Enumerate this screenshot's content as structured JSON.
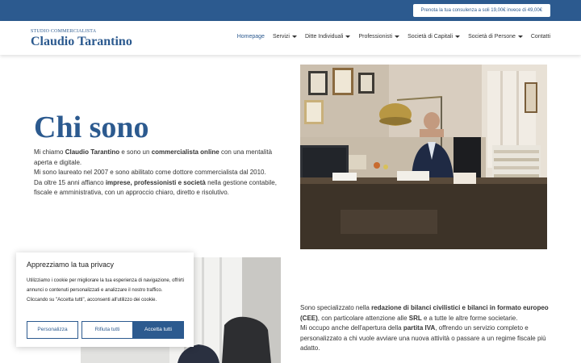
{
  "topbar": {
    "promo_label": "Prenota la tua consulenza a soli 19,00€ invece di 49,00€"
  },
  "brand": {
    "subtitle": "STUDIO COMMERCIALISTA",
    "name": "Claudio Tarantino"
  },
  "nav": {
    "items": [
      {
        "label": "Homepage",
        "active": true,
        "dropdown": false
      },
      {
        "label": "Servizi",
        "dropdown": true
      },
      {
        "label": "Ditte Individuali",
        "dropdown": true
      },
      {
        "label": "Professionisti",
        "dropdown": true
      },
      {
        "label": "Società di Capitali",
        "dropdown": true
      },
      {
        "label": "Società di Persone",
        "dropdown": true
      },
      {
        "label": "Contatti",
        "dropdown": false
      }
    ]
  },
  "main": {
    "title": "Chi sono",
    "intro": {
      "p1_a": "Mi chiamo ",
      "p1_b": "Claudio Tarantino",
      "p1_c": " e sono un ",
      "p1_d": "commercialista online",
      "p1_e": " con una mentalità aperta e digitale.",
      "p2": "Mi sono laureato nel 2007 e sono abilitato come dottore commercialista dal 2010.",
      "p3_a": "Da oltre 15 anni affianco ",
      "p3_b": "imprese, professionisti e società",
      "p3_c": " nella gestione contabile, fiscale e amministrativa, con un approccio chiaro, diretto e risolutivo."
    },
    "second": {
      "s1_a": "Sono specializzato nella ",
      "s1_b": "redazione di bilanci civilistici e bilanci in formato europeo (CEE)",
      "s1_c": ", con particolare attenzione alle ",
      "s1_d": "SRL",
      "s1_e": " e a tutte le altre forme societarie.",
      "s2_a": "Mi occupo anche dell'apertura della ",
      "s2_b": "partita IVA",
      "s2_c": ", offrendo un servizio completo e personalizzato a chi vuole avviare una nuova attività o passare a un regime fiscale più adatto."
    }
  },
  "cookie": {
    "title": "Apprezziamo la tua privacy",
    "text": "Utilizziamo i cookie per migliorare la tua esperienza di navigazione, offrirti annunci o contenuti personalizzati e analizzare il nostro traffico. Cliccando su \"Accetta tutti\", acconsenti all'utilizzo dei cookie.",
    "customize_label": "Personalizza",
    "reject_label": "Rifiuta tutti",
    "accept_label": "Accetta tutti"
  },
  "colors": {
    "brand": "#2c5a8f",
    "text": "#333333"
  }
}
